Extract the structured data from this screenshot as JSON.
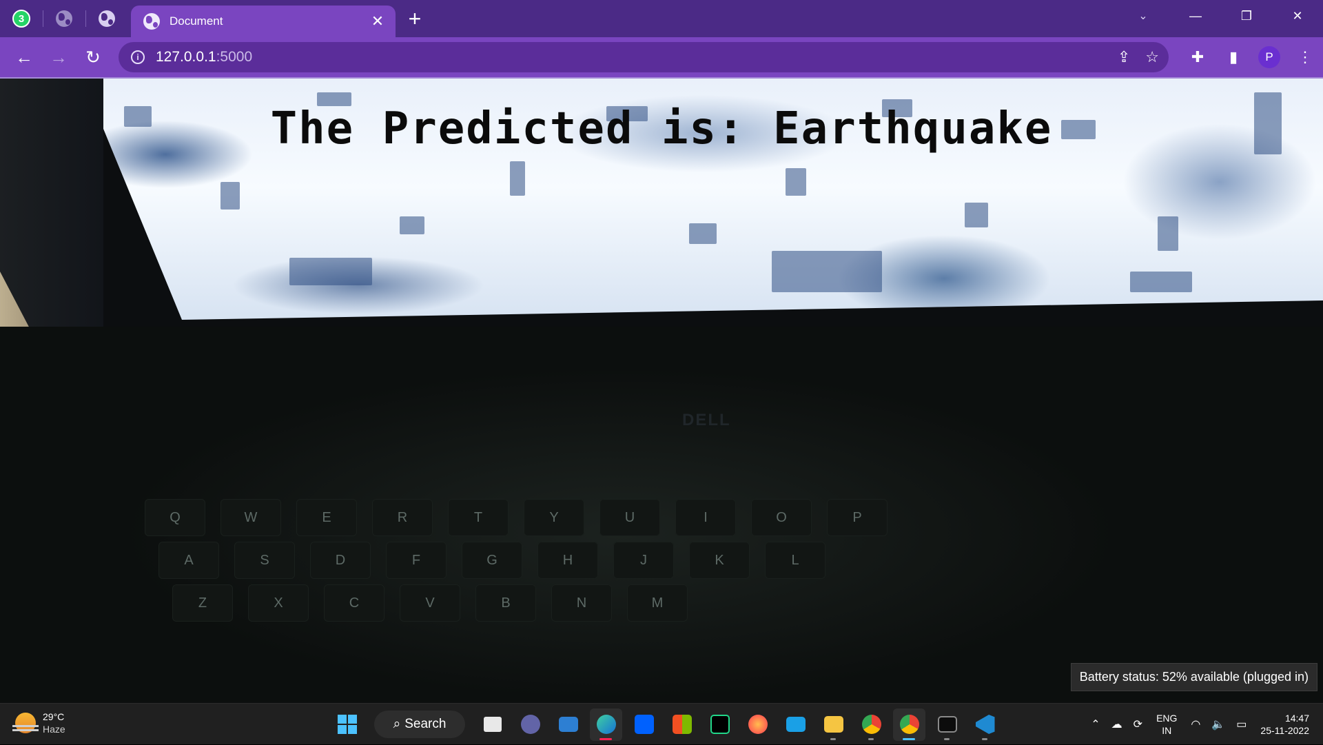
{
  "browser": {
    "pinned_tab_badge": "3",
    "active_tab_title": "Document",
    "url_host": "127.0.0.1",
    "url_port": ":5000",
    "profile_initial": "P"
  },
  "page": {
    "prediction_text": "The Predicted is: Earthquake",
    "laptop_brand": "DELL",
    "keyboard_rows": [
      [
        "Q",
        "W",
        "E",
        "R",
        "T",
        "Y",
        "U",
        "I",
        "O",
        "P"
      ],
      [
        "A",
        "S",
        "D",
        "F",
        "G",
        "H",
        "J",
        "K",
        "L"
      ],
      [
        "Z",
        "X",
        "C",
        "V",
        "B",
        "N",
        "M"
      ]
    ]
  },
  "tooltip": {
    "text": "Battery status: 52% available (plugged in)"
  },
  "taskbar": {
    "weather_temp": "29°C",
    "weather_condition": "Haze",
    "search_label": "Search",
    "language": "ENG",
    "region": "IN",
    "time": "14:47",
    "date": "25-11-2022"
  },
  "colors": {
    "tab_strip": "#4b2a86",
    "toolbar": "#7a45c0",
    "taskbar": "#202020",
    "accent": "#4cc2ff"
  }
}
